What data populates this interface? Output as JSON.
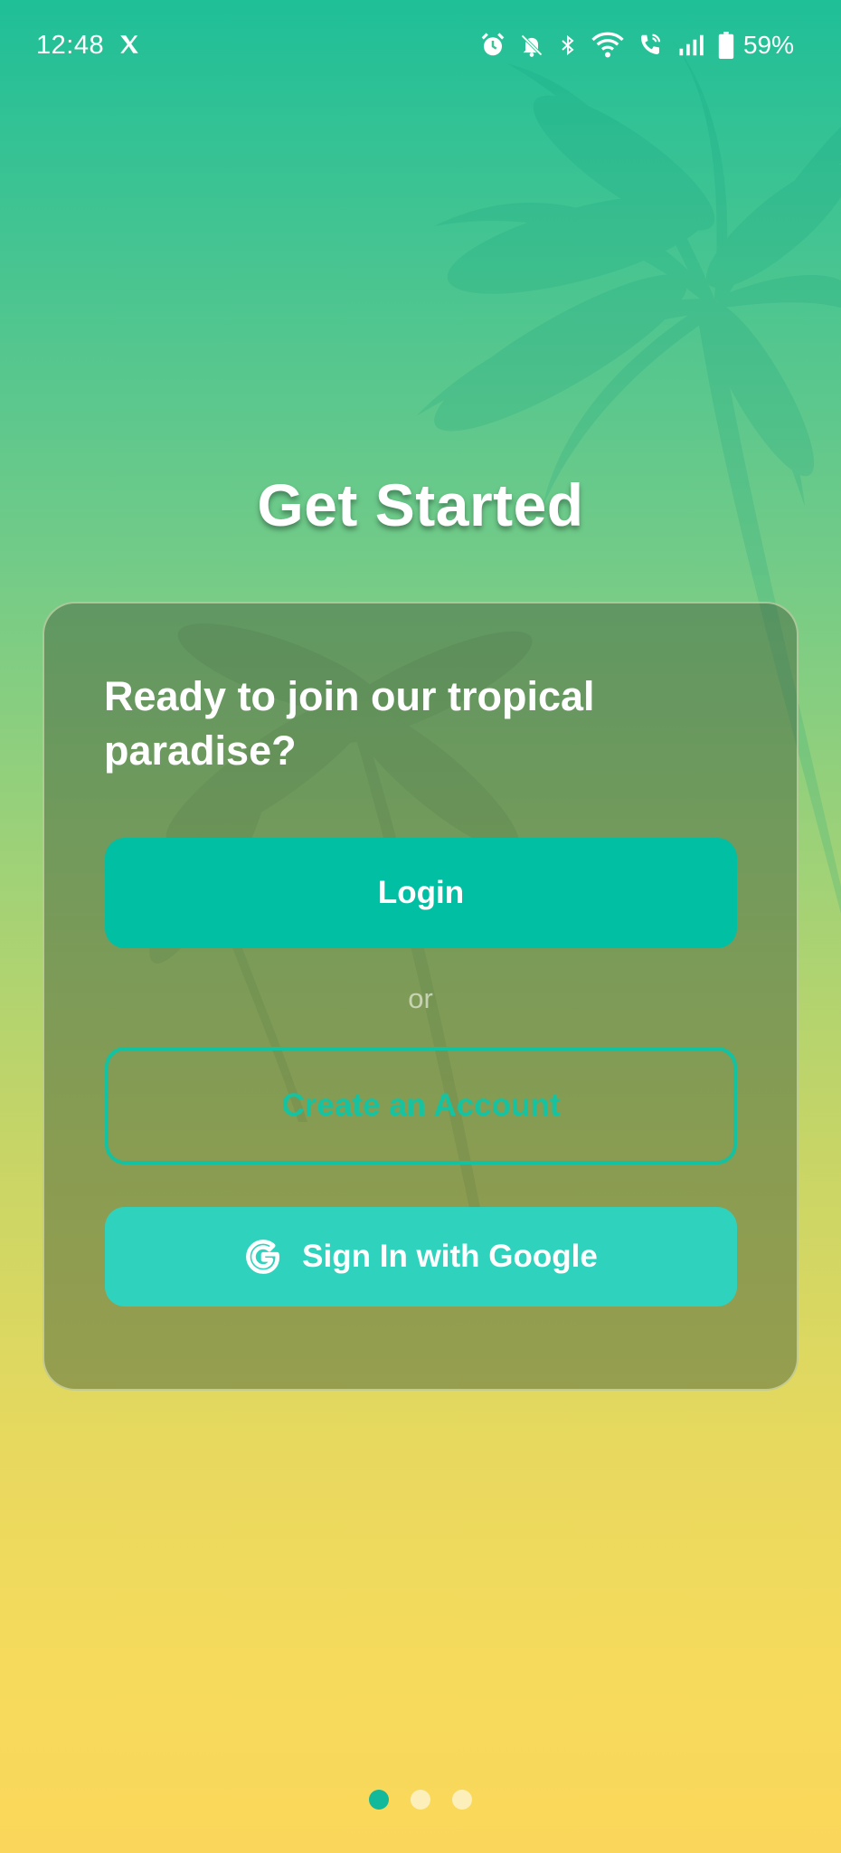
{
  "status_bar": {
    "time": "12:48",
    "battery": "59%",
    "icons": [
      "x-icon",
      "alarm-icon",
      "mute-icon",
      "bluetooth-icon",
      "wifi-icon",
      "wifi-call-icon",
      "signal-icon",
      "battery-icon"
    ]
  },
  "page": {
    "title": "Get Started"
  },
  "card": {
    "heading": "Ready to join our tropical paradise?",
    "login_label": "Login",
    "or_label": "or",
    "create_label": "Create an Account",
    "google_label": "Sign In with Google"
  },
  "pagination": {
    "total": 3,
    "active_index": 0
  },
  "colors": {
    "primary": "#00bfa3",
    "google_button": "#2fd3bd",
    "gradient_top": "#1fbf98",
    "gradient_bottom": "#fad75a"
  }
}
